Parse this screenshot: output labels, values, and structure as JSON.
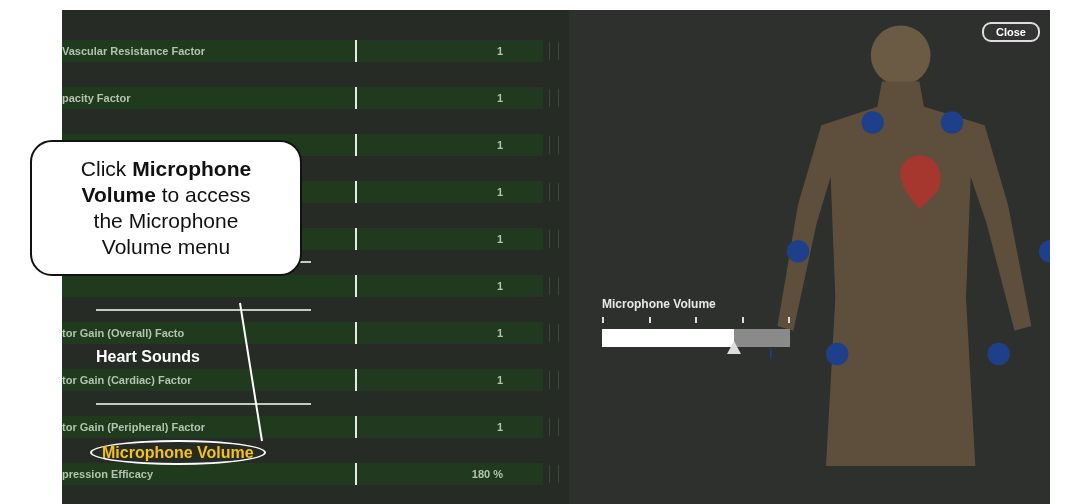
{
  "parameters": [
    {
      "label": "Vascular Resistance Factor",
      "value": "1"
    },
    {
      "label": "pacity Factor",
      "value": "1"
    },
    {
      "value": "1"
    },
    {
      "value": "1"
    },
    {
      "value": "1"
    },
    {
      "value": "1"
    },
    {
      "label": "tor Gain (Overall) Facto",
      "value": "1"
    },
    {
      "label": "tor Gain (Cardiac) Factor",
      "value": "1"
    },
    {
      "label": "tor Gain (Peripheral) Factor",
      "value": "1"
    },
    {
      "label": "pression Efficacy",
      "value": "180 %"
    }
  ],
  "menu": [
    {
      "label": "Heart Sounds",
      "selected": false,
      "circled": false
    },
    {
      "label": "Microphone Volume",
      "selected": true,
      "circled": true
    }
  ],
  "close_button": "Close",
  "volume": {
    "label": "Microphone Volume",
    "level": 0.7
  },
  "callout": {
    "text": "Click **Microphone Volume** to access the Microphone Volume menu"
  }
}
